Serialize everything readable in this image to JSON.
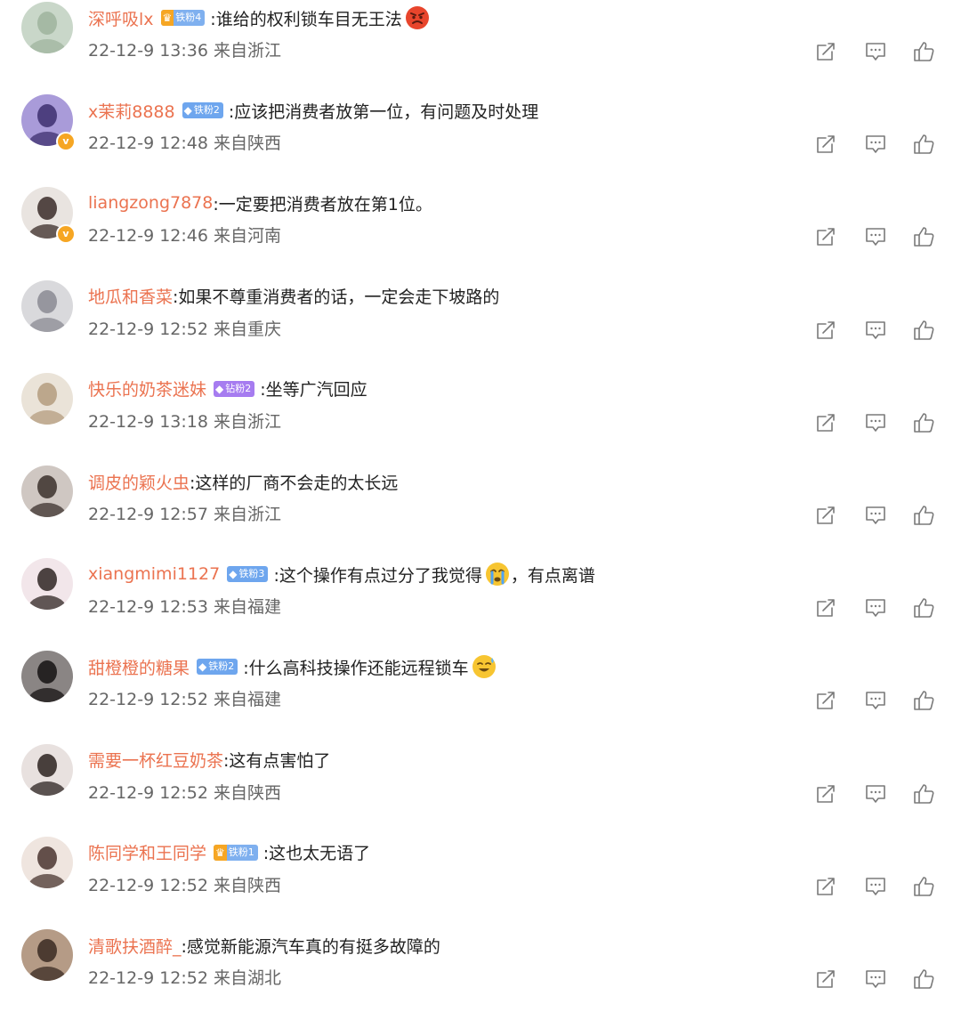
{
  "comments": [
    {
      "username": "深呼吸lx",
      "badge": {
        "type": "crown",
        "glyph": "♛",
        "label": "铁粉4"
      },
      "text": ":谁给的权利锁车目无王法",
      "emoji": "angry-face",
      "text_after_emoji": "",
      "meta": "22-12-9 13:36 来自浙江",
      "verified": false,
      "avatar_colors": [
        "#c9d7c9",
        "#9fb49e"
      ]
    },
    {
      "username": "x茉莉8888",
      "badge": {
        "type": "iron",
        "glyph": "◆",
        "label": "铁粉2"
      },
      "text": ":应该把消费者放第一位，有问题及时处理",
      "emoji": "",
      "text_after_emoji": "",
      "meta": "22-12-9 12:48 来自陕西",
      "verified": true,
      "avatar_colors": [
        "#a99bd9",
        "#3d2f6e"
      ]
    },
    {
      "username": "liangzong7878",
      "badge": null,
      "text": ":一定要把消费者放在第1位。",
      "emoji": "",
      "text_after_emoji": "",
      "meta": "22-12-9 12:46 来自河南",
      "verified": true,
      "avatar_colors": [
        "#e9e4e0",
        "#3a2c28"
      ]
    },
    {
      "username": "地瓜和香菜",
      "badge": null,
      "text": ":如果不尊重消费者的话，一定会走下坡路的",
      "emoji": "",
      "text_after_emoji": "",
      "meta": "22-12-9 12:52 来自重庆",
      "verified": false,
      "avatar_colors": [
        "#d9d9dc",
        "#8a8a93"
      ]
    },
    {
      "username": "快乐的奶茶迷妹",
      "badge": {
        "type": "diamond",
        "glyph": "◆",
        "label": "钻粉2"
      },
      "text": ":坐等广汽回应",
      "emoji": "",
      "text_after_emoji": "",
      "meta": "22-12-9 13:18 来自浙江",
      "verified": false,
      "avatar_colors": [
        "#eae3d8",
        "#b49c7f"
      ]
    },
    {
      "username": "调皮的颖火虫",
      "badge": null,
      "text": ":这样的厂商不会走的太长远",
      "emoji": "",
      "text_after_emoji": "",
      "meta": "22-12-9 12:57 来自浙江",
      "verified": false,
      "avatar_colors": [
        "#cfc7c2",
        "#3b302c"
      ]
    },
    {
      "username": "xiangmimi1127",
      "badge": {
        "type": "iron",
        "glyph": "◆",
        "label": "铁粉3"
      },
      "text": ":这个操作有点过分了我觉得",
      "emoji": "crying-face",
      "text_after_emoji": "，有点离谱",
      "meta": "22-12-9 12:53 来自福建",
      "verified": false,
      "avatar_colors": [
        "#f2e6ea",
        "#2f2523"
      ]
    },
    {
      "username": "甜橙橙的糖果",
      "badge": {
        "type": "iron",
        "glyph": "◆",
        "label": "铁粉2"
      },
      "text": ":什么高科技操作还能远程锁车",
      "emoji": "sweat-smile-face",
      "text_after_emoji": "",
      "meta": "22-12-9 12:52 来自福建",
      "verified": false,
      "avatar_colors": [
        "#8a8584",
        "#141212"
      ]
    },
    {
      "username": "需要一杯红豆奶茶",
      "badge": null,
      "text": ":这有点害怕了",
      "emoji": "",
      "text_after_emoji": "",
      "meta": "22-12-9 12:52 来自陕西",
      "verified": false,
      "avatar_colors": [
        "#e8e1df",
        "#2b2220"
      ]
    },
    {
      "username": "陈同学和王同学",
      "badge": {
        "type": "crown",
        "glyph": "♛",
        "label": "铁粉1"
      },
      "text": ":这也太无语了",
      "emoji": "",
      "text_after_emoji": "",
      "meta": "22-12-9 12:52 来自陕西",
      "verified": false,
      "avatar_colors": [
        "#efe5df",
        "#4a3530"
      ]
    },
    {
      "username": "清歌扶酒醉_",
      "badge": null,
      "text": ":感觉新能源汽车真的有挺多故障的",
      "emoji": "",
      "text_after_emoji": "",
      "meta": "22-12-9 12:52 来自湖北",
      "verified": false,
      "avatar_colors": [
        "#b59b86",
        "#3a2a22"
      ]
    }
  ],
  "icons": {
    "share": "share-icon",
    "comment": "comment-icon",
    "like": "like-icon",
    "verified": "verified-icon"
  },
  "colors": {
    "username": "#eb7350",
    "text": "#222222",
    "meta": "#666666",
    "icon": "#7a7a7a",
    "verified": "#f6a623"
  }
}
